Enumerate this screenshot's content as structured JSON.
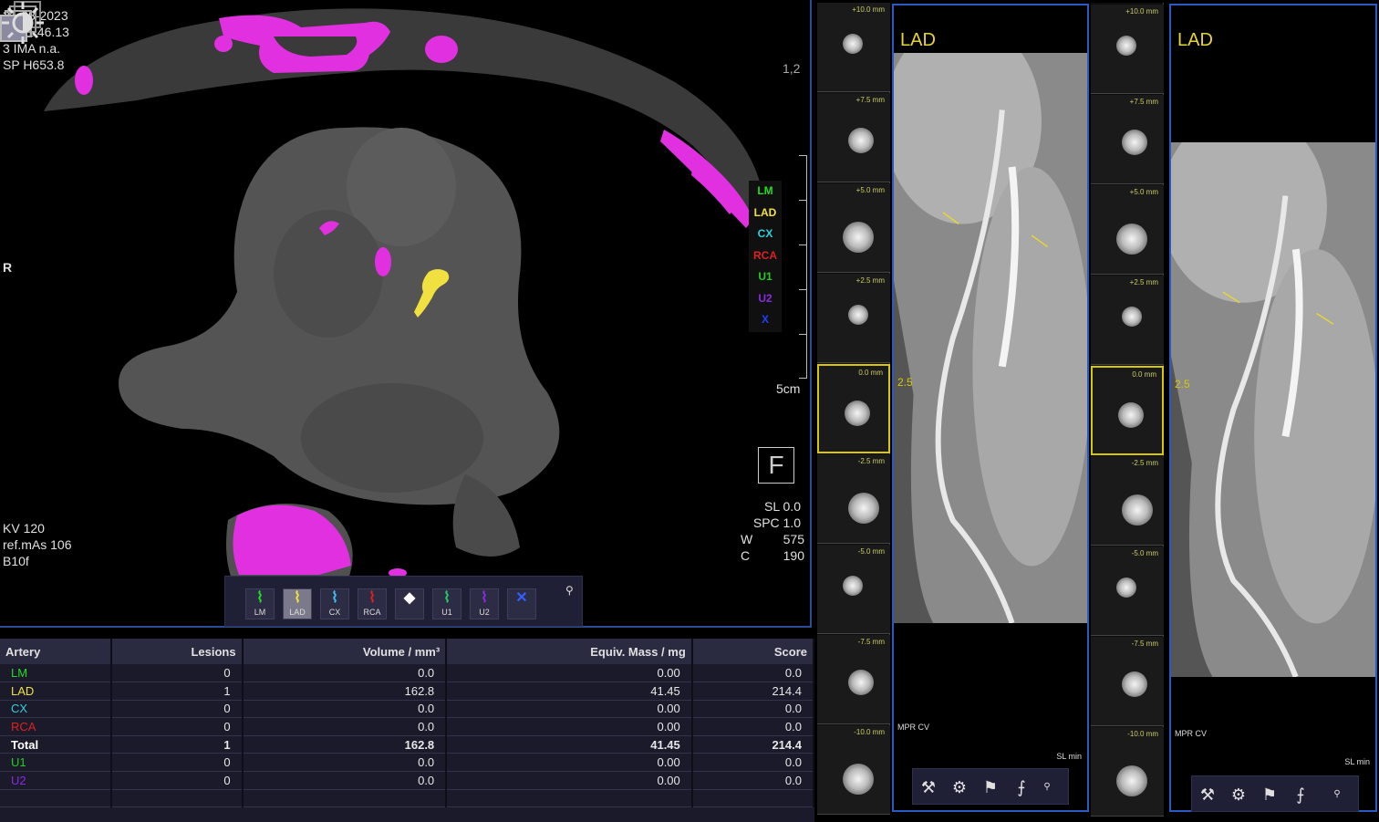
{
  "axial": {
    "date": "21-08-2023",
    "time": "11:51:46.13",
    "series": "3 IMA n.a.",
    "position": "SP H653.8",
    "orientation": "R",
    "zoom": "1,2",
    "kv": "KV 120",
    "ref_mas": "ref.mAs 106",
    "kernel": "B10f",
    "scale": "5cm",
    "sl": "SL 0.0",
    "spc": "SPC 1.0",
    "w_label": "W",
    "w_value": "575",
    "c_label": "C",
    "c_value": "190",
    "view_marker": "F",
    "legend": [
      {
        "label": "LM",
        "color": "#22dd22"
      },
      {
        "label": "LAD",
        "color": "#f0e040"
      },
      {
        "label": "CX",
        "color": "#30d0e0"
      },
      {
        "label": "RCA",
        "color": "#e02020"
      },
      {
        "label": "U1",
        "color": "#22cc22"
      },
      {
        "label": "U2",
        "color": "#8a2be2"
      },
      {
        "label": "X",
        "color": "#2040ff"
      }
    ]
  },
  "toolbar": {
    "buttons": [
      {
        "label": "LM",
        "color": "#22dd22",
        "active": false
      },
      {
        "label": "LAD",
        "color": "#f0e040",
        "active": true
      },
      {
        "label": "CX",
        "color": "#40c0f0",
        "active": false
      },
      {
        "label": "RCA",
        "color": "#e02020",
        "active": false
      },
      {
        "label": "",
        "color": "#ffffff",
        "active": false
      },
      {
        "label": "U1",
        "color": "#22cc66",
        "active": false
      },
      {
        "label": "U2",
        "color": "#8a2be2",
        "active": false
      },
      {
        "label": "",
        "color": "#3060ff",
        "active": false
      }
    ]
  },
  "results": {
    "headers": [
      "Artery",
      "Lesions",
      "Volume / mm³",
      "Equiv. Mass / mg",
      "Score"
    ],
    "rows": [
      {
        "artery": "LM",
        "color": "#22dd22",
        "lesions": "0",
        "volume": "0.0",
        "mass": "0.00",
        "score": "0.0"
      },
      {
        "artery": "LAD",
        "color": "#f0e040",
        "lesions": "1",
        "volume": "162.8",
        "mass": "41.45",
        "score": "214.4"
      },
      {
        "artery": "CX",
        "color": "#30d0e0",
        "lesions": "0",
        "volume": "0.0",
        "mass": "0.00",
        "score": "0.0"
      },
      {
        "artery": "RCA",
        "color": "#e02020",
        "lesions": "0",
        "volume": "0.0",
        "mass": "0.00",
        "score": "0.0"
      },
      {
        "artery": "Total",
        "color": "#ffffff",
        "lesions": "1",
        "volume": "162.8",
        "mass": "41.45",
        "score": "214.4"
      },
      {
        "artery": "U1",
        "color": "#22cc22",
        "lesions": "0",
        "volume": "0.0",
        "mass": "0.00",
        "score": "0.0"
      },
      {
        "artery": "U2",
        "color": "#8a2be2",
        "lesions": "0",
        "volume": "0.0",
        "mass": "0.00",
        "score": "0.0"
      },
      {
        "artery": "",
        "color": "#ffffff",
        "lesions": "",
        "volume": "",
        "mass": "",
        "score": ""
      }
    ]
  },
  "mpr": [
    {
      "title": "LAD",
      "side_value": "2.5",
      "label": "MPR CV",
      "sl_min": "SL min",
      "sections": [
        "+10.0 mm",
        "+7.5 mm",
        "+5.0 mm",
        "+2.5 mm",
        "0.0 mm",
        "-2.5 mm",
        "-5.0 mm",
        "-7.5 mm",
        "-10.0 mm"
      ]
    },
    {
      "title": "LAD",
      "side_value": "2.5",
      "label": "MPR CV",
      "sl_min": "SL min",
      "sections": [
        "+10.0 mm",
        "+7.5 mm",
        "+5.0 mm",
        "+2.5 mm",
        "0.0 mm",
        "-2.5 mm",
        "-5.0 mm",
        "-7.5 mm",
        "-10.0 mm"
      ]
    }
  ],
  "mpr_toolbar_icons": [
    "wrench-icon",
    "gear-icon",
    "flag-icon",
    "measure-icon"
  ]
}
